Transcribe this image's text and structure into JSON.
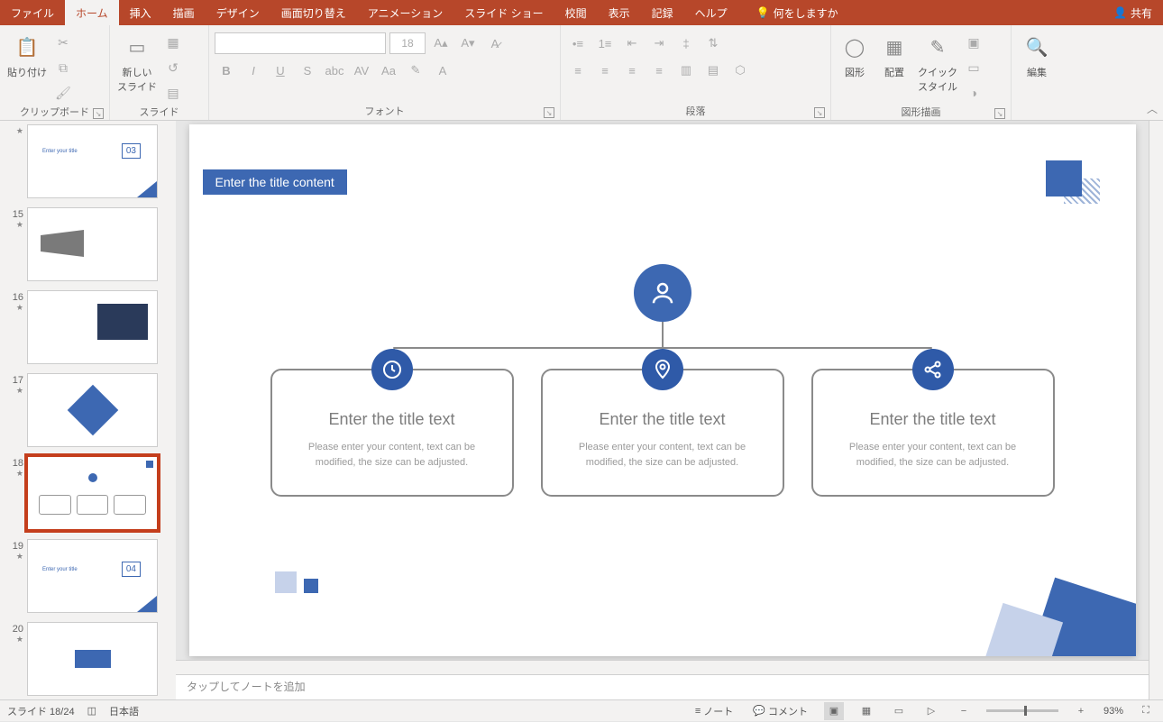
{
  "tabs": {
    "file": "ファイル",
    "home": "ホーム",
    "insert": "挿入",
    "draw": "描画",
    "design": "デザイン",
    "transitions": "画面切り替え",
    "animations": "アニメーション",
    "slideshow": "スライド ショー",
    "review": "校閲",
    "view": "表示",
    "record": "記録",
    "help": "ヘルプ",
    "tellme": "何をしますか",
    "share": "共有"
  },
  "ribbon": {
    "clipboard": {
      "paste": "貼り付け",
      "label": "クリップボード"
    },
    "slides": {
      "new_slide": "新しい\nスライド",
      "label": "スライド"
    },
    "font": {
      "size": "18",
      "label": "フォント"
    },
    "paragraph": {
      "label": "段落"
    },
    "drawing": {
      "shapes": "図形",
      "arrange": "配置",
      "quick_styles": "クイック\nスタイル",
      "label": "図形描画"
    },
    "editing": {
      "label": "編集"
    }
  },
  "thumbnails": {
    "slide14_num": "",
    "slide15_num": "15",
    "slide16_num": "16",
    "slide17_num": "17",
    "slide18_num": "18",
    "slide19_num": "19",
    "slide20_num": "20"
  },
  "slide": {
    "title_tag": "Enter the title content",
    "cards": [
      {
        "title": "Enter the title text",
        "body": "Please enter your content, text can be modified, the size can be adjusted."
      },
      {
        "title": "Enter the title text",
        "body": "Please enter your content, text can be modified, the size can be adjusted."
      },
      {
        "title": "Enter the title text",
        "body": "Please enter your content, text can be modified, the size can be adjusted."
      }
    ]
  },
  "thumb_content": {
    "enter_title": "Enter your title",
    "num03": "03",
    "num04": "04"
  },
  "notes": {
    "placeholder": "タップしてノートを追加"
  },
  "status": {
    "slide_counter": "スライド 18/24",
    "language": "日本語",
    "notes_btn": "ノート",
    "comments_btn": "コメント",
    "zoom": "93%"
  },
  "colors": {
    "accent": "#b7472a",
    "slide_blue": "#3d68b2"
  }
}
